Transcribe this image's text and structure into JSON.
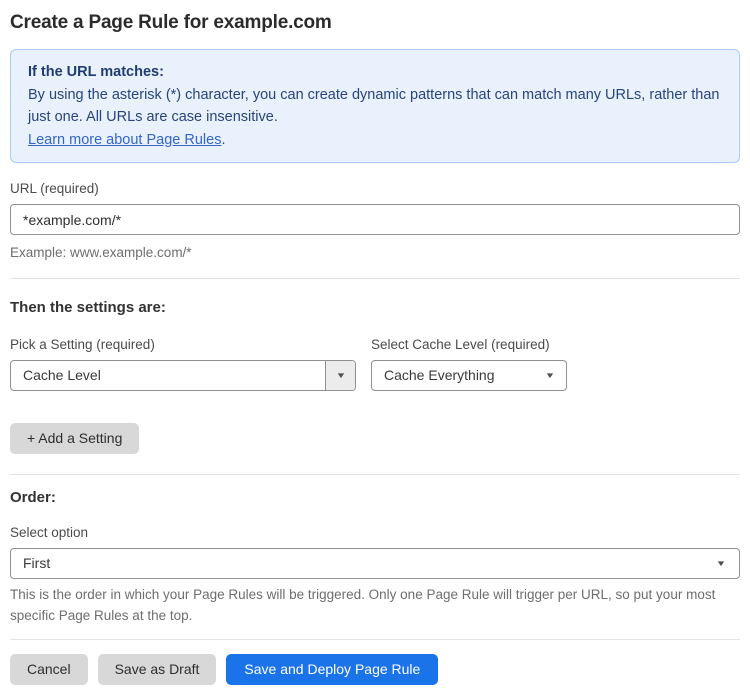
{
  "page": {
    "title": "Create a Page Rule for example.com"
  },
  "info_box": {
    "heading": "If the URL matches:",
    "body": "By using the asterisk (*) character, you can create dynamic patterns that can match many URLs, rather than just one. All URLs are case insensitive.",
    "link": "Learn more about Page Rules",
    "link_suffix": "."
  },
  "url_field": {
    "label": "URL (required)",
    "value": "*example.com/*",
    "help": "Example: www.example.com/*"
  },
  "settings_section": {
    "heading": "Then the settings are:",
    "setting_label": "Pick a Setting (required)",
    "setting_value": "Cache Level",
    "cache_label": "Select Cache Level (required)",
    "cache_value": "Cache Everything",
    "add_button": "+ Add a Setting"
  },
  "order_section": {
    "heading": "Order:",
    "label": "Select option",
    "value": "First",
    "help": "This is the order in which your Page Rules will be triggered. Only one Page Rule will trigger per URL, so put your most specific Page Rules at the top."
  },
  "footer": {
    "cancel": "Cancel",
    "save_draft": "Save as Draft",
    "save_deploy": "Save and Deploy Page Rule"
  },
  "icons": {
    "dropdown_arrow": "chevron-down-icon"
  },
  "colors": {
    "accent_blue": "#1a73e8",
    "info_bg": "#e8f1fc",
    "info_border": "#abcdf0",
    "info_text": "#29447d",
    "link_blue": "#3566c6",
    "button_gray": "#d8d8d8"
  }
}
